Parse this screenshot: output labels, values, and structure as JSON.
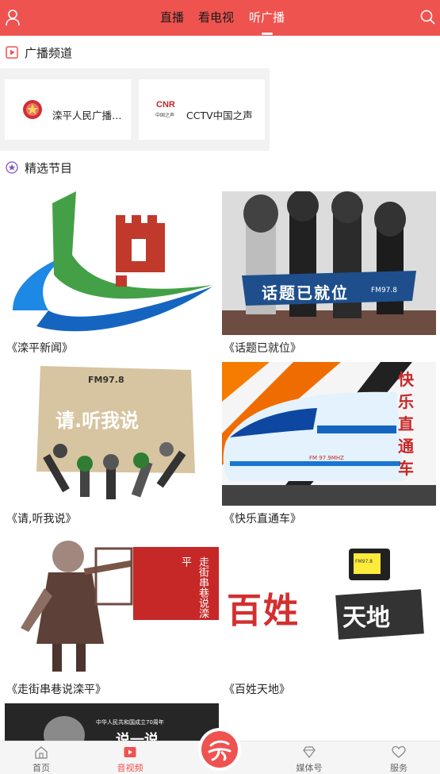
{
  "header": {
    "tabs": [
      {
        "label": "直播",
        "active": false
      },
      {
        "label": "看电视",
        "active": false
      },
      {
        "label": "听广播",
        "active": true
      }
    ],
    "accent_color": "#ef5350"
  },
  "channels_section": {
    "title": "广播频道",
    "icon": "play-square-icon",
    "channels": [
      {
        "name": "滦平人民广播…",
        "logo": "emblem-logo"
      },
      {
        "name": "CCTV中国之声",
        "logo": "cnr-logo",
        "logo_text": "CNR",
        "logo_subtext": "中国之声"
      }
    ]
  },
  "programs_section": {
    "title": "精选节目",
    "icon": "star-circle-icon",
    "programs": [
      {
        "title": "《滦平新闻》"
      },
      {
        "title": "《话题已就位》",
        "thumb_text": "话题已就位",
        "thumb_subtext": "FM97.8"
      },
      {
        "title": "《请,听我说》",
        "thumb_text": "请.听我说",
        "thumb_subtext": "FM97.8"
      },
      {
        "title": "《快乐直通车》",
        "thumb_text": "快乐直通车",
        "thumb_subtext": "FM 97.9MHZ"
      },
      {
        "title": "《走街串巷说滦平》",
        "thumb_text": "走街串巷说滦平"
      },
      {
        "title": "《百姓天地》",
        "thumb_text": "百姓",
        "thumb_text2": "天地",
        "thumb_subtext": "FM97.8"
      },
      {
        "title": "",
        "thumb_text": "中华人民共和国成立70周年",
        "thumb_text2": "说一说"
      }
    ]
  },
  "bottom_nav": {
    "items": [
      {
        "label": "首页",
        "icon": "home-icon",
        "active": false
      },
      {
        "label": "音视频",
        "icon": "video-play-icon",
        "active": true
      },
      {
        "label": "",
        "icon": "center-logo-icon",
        "active": false
      },
      {
        "label": "媒体号",
        "icon": "diamond-icon",
        "active": false
      },
      {
        "label": "服务",
        "icon": "heart-icon",
        "active": false
      }
    ]
  }
}
